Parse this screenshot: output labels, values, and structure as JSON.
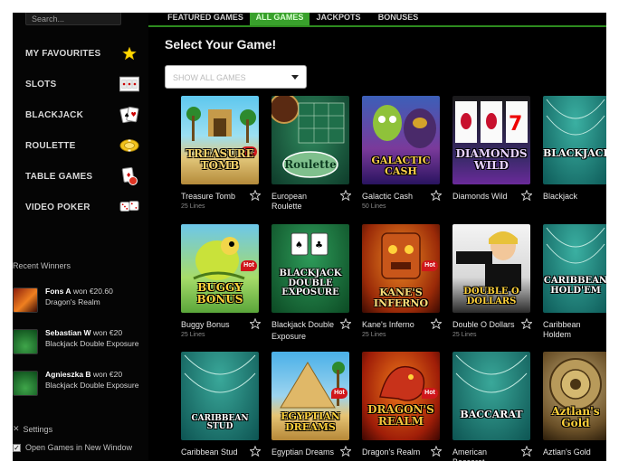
{
  "search": {
    "placeholder": "Search..."
  },
  "sidebar": {
    "menu": [
      {
        "label": "MY FAVOURITES",
        "icon": "star-icon"
      },
      {
        "label": "SLOTS",
        "icon": "slot-reels-icon"
      },
      {
        "label": "BLACKJACK",
        "icon": "playing-cards-icon"
      },
      {
        "label": "ROULETTE",
        "icon": "casino-chips-icon"
      },
      {
        "label": "TABLE GAMES",
        "icon": "card-and-chip-icon"
      },
      {
        "label": "VIDEO POKER",
        "icon": "dice-icon"
      }
    ],
    "recent_winners_title": "Recent Winners",
    "winners": [
      {
        "line1_name": "Fons A",
        "line1_rest": " won €20.60",
        "line2": "Dragon's Realm"
      },
      {
        "line1_name": "Sebastian W",
        "line1_rest": " won €20",
        "line2": "Blackjack Double Exposure"
      },
      {
        "line1_name": "Agnieszka B",
        "line1_rest": " won €20",
        "line2": "Blackjack Double Exposure"
      }
    ],
    "settings_title": "Settings",
    "open_new_window_label": "Open Games in New Window",
    "open_new_window_checked": true
  },
  "tabs": [
    {
      "label": "FEATURED GAMES",
      "active": false
    },
    {
      "label": "ALL GAMES",
      "active": true
    },
    {
      "label": "JACKPOTS",
      "active": false
    },
    {
      "label": "BONUSES",
      "active": false
    }
  ],
  "main": {
    "heading": "Select Your Game!",
    "filter_value": "SHOW ALL GAMES",
    "hot_label": "Hot"
  },
  "games": [
    {
      "name": "Treasure Tomb",
      "sub": "25 Lines",
      "hot": true,
      "logo": "TREASURE TOMB"
    },
    {
      "name": "European Roulette",
      "sub": "",
      "hot": false,
      "logo": "Roulette"
    },
    {
      "name": "Galactic Cash",
      "sub": "50 Lines",
      "hot": false,
      "logo": "GALACTIC CASH"
    },
    {
      "name": "Diamonds Wild",
      "sub": "",
      "hot": false,
      "logo": "DIAMONDS WILD"
    },
    {
      "name": "Blackjack",
      "sub": "",
      "hot": false,
      "logo": "BLACKJACK"
    },
    {
      "name": "Buggy Bonus",
      "sub": "25 Lines",
      "hot": true,
      "logo": "BUGGY BONUS"
    },
    {
      "name": "Blackjack Double",
      "sub": "Exposure",
      "hot": false,
      "logo": "BLACKJACK DOUBLE EXPOSURE"
    },
    {
      "name": "Kane's Inferno",
      "sub": "25 Lines",
      "hot": true,
      "logo": "KANE'S INFERNO"
    },
    {
      "name": "Double O Dollars",
      "sub": "25 Lines",
      "hot": false,
      "logo": "DOUBLE O DOLLARS"
    },
    {
      "name": "Caribbean Holdem",
      "sub": "",
      "hot": false,
      "logo": "CARIBBEAN HOLD'EM"
    },
    {
      "name": "Caribbean Stud",
      "sub": "",
      "hot": false,
      "logo": "CARIBBEAN STUD"
    },
    {
      "name": "Egyptian Dreams",
      "sub": "",
      "hot": true,
      "logo": "EGYPTIAN DREAMS"
    },
    {
      "name": "Dragon's Realm",
      "sub": "",
      "hot": true,
      "logo": "DRAGON'S REALM"
    },
    {
      "name": "American Baccarat",
      "sub": "",
      "hot": false,
      "logo": "BACCARAT"
    },
    {
      "name": "Aztlan's Gold",
      "sub": "",
      "hot": false,
      "logo": "Aztlan's Gold"
    }
  ],
  "colors": {
    "accent_green": "#39a12c",
    "favourite_star": "#ffd700",
    "hot_badge": "#d0161b"
  }
}
